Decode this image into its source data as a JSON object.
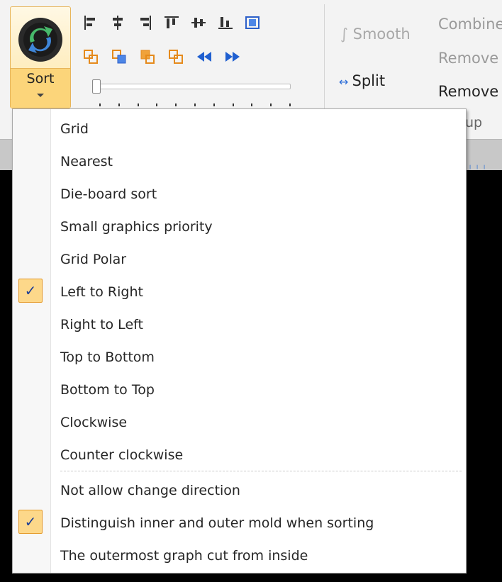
{
  "ribbon": {
    "sort_button": {
      "label": "Sort"
    },
    "smooth_label": "Smooth",
    "split_label": "Split",
    "combine_label": "Combine",
    "remove_label_1": "Remove",
    "remove_label_2": "Remove",
    "group_label": "up"
  },
  "menu": {
    "items": [
      {
        "label": "Grid",
        "checked": false
      },
      {
        "label": "Nearest",
        "checked": false
      },
      {
        "label": "Die-board sort",
        "checked": false
      },
      {
        "label": "Small graphics priority",
        "checked": false
      },
      {
        "label": "Grid Polar",
        "checked": false
      },
      {
        "label": "Left to Right",
        "checked": true
      },
      {
        "label": "Right to Left",
        "checked": false
      },
      {
        "label": "Top to Bottom",
        "checked": false
      },
      {
        "label": "Bottom to Top",
        "checked": false
      },
      {
        "label": "Clockwise",
        "checked": false
      },
      {
        "label": "Counter clockwise",
        "checked": false
      },
      {
        "label": "Not allow change direction",
        "checked": false
      },
      {
        "label": "Distinguish inner and outer mold when sorting",
        "checked": true
      },
      {
        "label": "The outermost graph cut from inside",
        "checked": false
      }
    ],
    "check_glyph": "✓"
  },
  "colors": {
    "accent_check_bg": "#fdd88a",
    "accent_check_border": "#e59a2a",
    "check_mark": "#1f3f95"
  }
}
